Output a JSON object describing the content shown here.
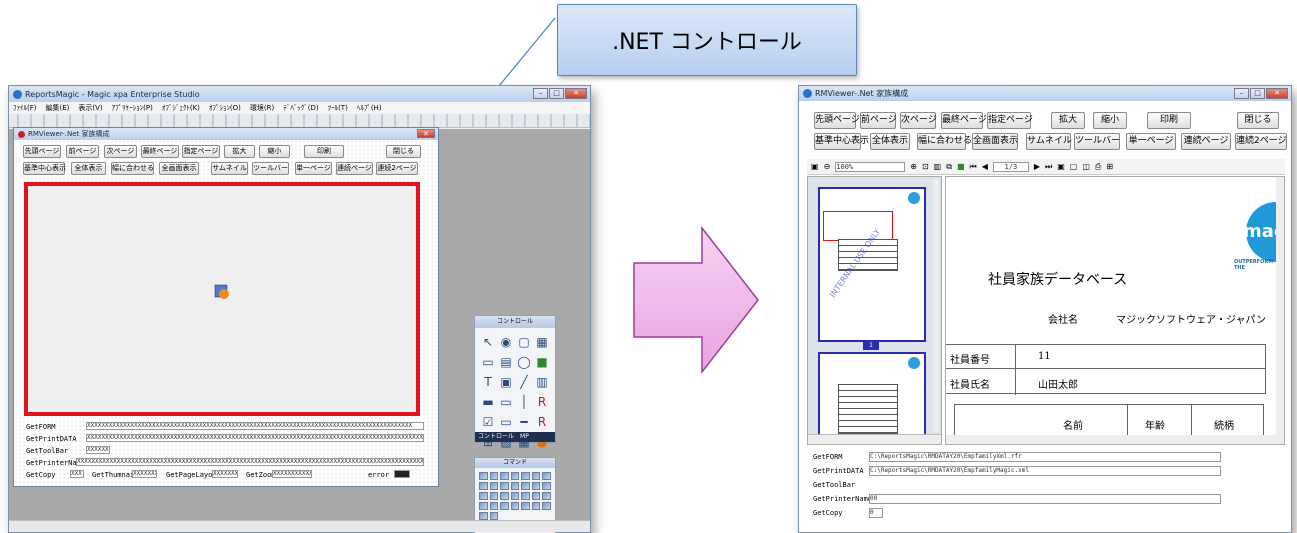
{
  "callout": {
    "text": ".NET コントロール"
  },
  "left_window": {
    "title": "ReportsMagic - Magic xpa Enterprise Studio",
    "menu": [
      "ﾌｧｲﾙ(F)",
      "編集(E)",
      "表示(V)",
      "ｱﾌﾟﾘｹｰｼｮﾝ(P)",
      "ｵﾌﾞｼﾞｪｸﾄ(K)",
      "ｵﾌﾟｼｮﾝ(O)",
      "環境(R)",
      "ﾃﾞﾊﾞｯｸﾞ(D)",
      "ﾂｰﾙ(T)",
      "ﾍﾙﾌﾟ(H)"
    ],
    "form_title": "RMViewer-.Net 家族構成",
    "row1": [
      "先頭ページ",
      "前ページ",
      "次ページ",
      "最終ページ",
      "指定ページ",
      "拡大",
      "縮小",
      "印刷",
      "閉じる"
    ],
    "row2": [
      "基準中心表示",
      "全体表示",
      "幅に合わせる",
      "全画面表示",
      "サムネイル",
      "ツールバー",
      "単一ページ",
      "連続ページ",
      "連続2ページ"
    ],
    "fields": [
      {
        "label": "GetFORM",
        "value": "XXXXXXXXXXXXXXXXXXXXXXXXXXXXXXXXXXXXXXXXXXXXXXXXXXXXXXXXXXXXXXXXXXXXXXXXXXXXXXXXXXXXXXXXXX"
      },
      {
        "label": "GetPrintDATA",
        "value": "XXXXXXXXXXXXXXXXXXXXXXXXXXXXXXXXXXXXXXXXXXXXXXXXXXXXXXXXXXXXXXXXXXXXXXXXXXXXXXXXXXXXXXXXXXXXXXX"
      },
      {
        "label": "GetToolBar",
        "value": "XXXXXX"
      },
      {
        "label": "GetPrinterName",
        "value": "XXXXXXXXXXXXXXXXXXXXXXXXXXXXXXXXXXXXXXXXXXXXXXXXXXXXXXXXXXXXXXXXXXXXXXXXXXXXXXXXXXXXXXXXXXXXXXXX"
      }
    ],
    "bottom": {
      "getcopy": "GetCopy",
      "getcopy_val": "XXX",
      "thumb": "GetThumnail",
      "thumb_val": "XXXXXXX",
      "layout": "GetPageLayout",
      "layout_val": "XXXXXXX",
      "zoom": "GetZoom",
      "zoom_val": "XXXXXXXXXXX",
      "error": "error"
    },
    "palette_title": "コントロール",
    "palette_tab": "コントロール",
    "palette_tab2": "MP",
    "palette2_title": "コマンド"
  },
  "right_window": {
    "title": "RMViewer-.Net 家族構成",
    "row1": [
      "先頭ページ",
      "前ページ",
      "次ページ",
      "最終ページ",
      "指定ページ",
      "拡大",
      "縮小",
      "印刷",
      "閉じる"
    ],
    "row2": [
      "基準中心表示",
      "全体表示",
      "幅に合わせる",
      "全画面表示",
      "サムネイル",
      "ツールバー",
      "単一ページ",
      "連続ページ",
      "連続2ページ"
    ],
    "zoom": "100%",
    "page": "1/3",
    "thumb_page": "1",
    "doc": {
      "heading": "社員家族データベース",
      "company_label": "会社名",
      "company": "マジックソフトウェア・ジャパン",
      "emp_no_label": "社員番号",
      "emp_no": "11",
      "emp_name_label": "社員氏名",
      "emp_name": "山田太郎",
      "col_name": "名前",
      "col_age": "年齢",
      "col_rel": "続柄",
      "logo": "mag",
      "tagline": "OUTPERFORM THE",
      "watermark": "INTERNAL USE ONLY"
    },
    "fields": [
      {
        "label": "GetFORM",
        "value": "C:\\ReportsMagic\\RMDATAY20\\EmpfamilyXml.rfr"
      },
      {
        "label": "GetPrintDATA",
        "value": "C:\\ReportsMagic\\RMDATAY20\\EmpfamilyMagic.xml"
      },
      {
        "label": "GetToolBar",
        "value": ""
      },
      {
        "label": "GetPrinterName",
        "value": "00"
      },
      {
        "label": "GetCopy",
        "value": "0"
      }
    ]
  },
  "colors": {
    "highlight": "#e0151b",
    "arrow_fill": "#f0b8ea",
    "arrow_stroke": "#9b3e9b",
    "callout_border": "#5a83c0"
  }
}
